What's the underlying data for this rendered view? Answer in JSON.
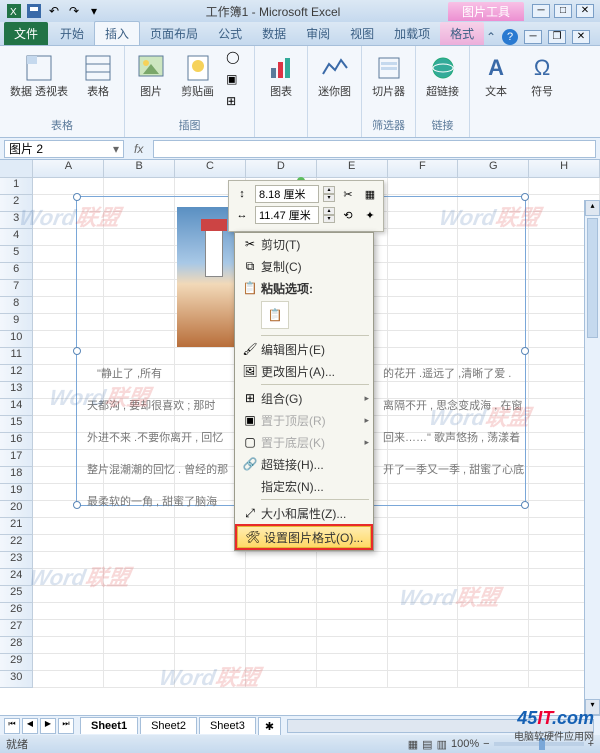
{
  "titlebar": {
    "title": "工作簿1 - Microsoft Excel",
    "tool_context": "图片工具"
  },
  "tabs": {
    "file": "文件",
    "home": "开始",
    "insert": "插入",
    "layout": "页面布局",
    "formula": "公式",
    "data": "数据",
    "review": "审阅",
    "view": "视图",
    "addins": "加载项",
    "format": "格式"
  },
  "ribbon": {
    "tables": {
      "title": "表格",
      "pivot": "数据\n透视表",
      "table": "表格"
    },
    "illustrations": {
      "title": "插图",
      "picture": "图片",
      "clipart": "剪贴画"
    },
    "charts": {
      "title": "图表",
      "chart": "图表"
    },
    "sparklines": {
      "title": "迷你图",
      "spark": "迷你图"
    },
    "filter": {
      "title": "筛选器",
      "slicer": "切片器"
    },
    "links": {
      "title": "链接",
      "hyper": "超链接"
    },
    "text": {
      "text": "文本"
    },
    "symbols": {
      "symbol": "符号"
    }
  },
  "namebox": "图片 2",
  "formula": "fx",
  "columns": [
    "A",
    "B",
    "C",
    "D",
    "E",
    "F",
    "G",
    "H"
  ],
  "rows": [
    "1",
    "2",
    "3",
    "4",
    "5",
    "6",
    "7",
    "8",
    "9",
    "10",
    "11",
    "12",
    "13",
    "14",
    "15",
    "16",
    "17",
    "18",
    "19",
    "20",
    "21",
    "22",
    "23",
    "24",
    "25",
    "26",
    "27",
    "28",
    "29",
    "30"
  ],
  "mini": {
    "height": "8.18 厘米",
    "width": "11.47 厘米"
  },
  "context": {
    "cut": "剪切(T)",
    "copy": "复制(C)",
    "paste_header": "粘贴选项:",
    "edit_pic": "编辑图片(E)",
    "change_pic": "更改图片(A)...",
    "group": "组合(G)",
    "bring_front": "置于顶层(R)",
    "send_back": "置于底层(K)",
    "hyperlink": "超链接(H)...",
    "assign_macro": "指定宏(N)...",
    "size_props": "大小和属性(Z)...",
    "format_pic": "设置图片格式(O)..."
  },
  "textlines": {
    "l1a": "\"静止了 ,所有",
    "l1b": "的花开 .遥远了 ,清晰了爱 .",
    "l2a": "天都沟 , 要却很喜欢 ; 那时",
    "l2b": "离隔不开 , 思念变成海 , 在窗",
    "l3a": "外进不来 .不要你离开 , 回忆",
    "l3b": "回来……\" 歌声悠扬 , 荡漾着",
    "l4a": "整片混潮潮的回忆 . 曾经的那",
    "l4b": "开了一季又一季 , 甜蜜了心底",
    "l5a": "最柔软的一角 , 甜蜜了脑海"
  },
  "sheets": {
    "s1": "Sheet1",
    "s2": "Sheet2",
    "s3": "Sheet3"
  },
  "status": {
    "ready": "就绪",
    "zoom": "100%"
  },
  "watermark": {
    "prefix": "Word",
    "suffix": "联盟"
  },
  "logo": {
    "brand": "45IT.com",
    "sub": "电脑软硬件应用网"
  }
}
